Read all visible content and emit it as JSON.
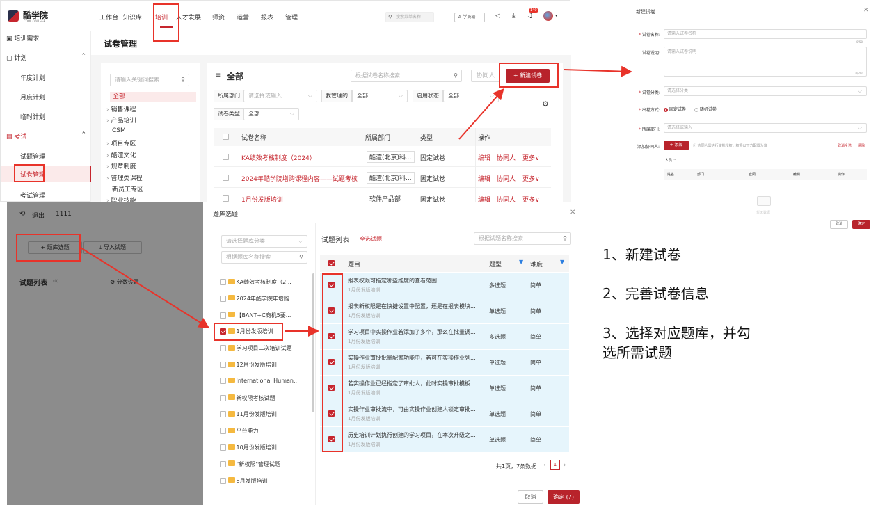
{
  "app": {
    "logo_cn": "酷学院",
    "logo_en": "COOL COLLEGE",
    "nav": [
      "工作台",
      "知识库",
      "培训",
      "人才发展",
      "师资",
      "运营",
      "报表",
      "管理"
    ],
    "search_placeholder": "搜索菜单名称",
    "role_label": "学员端",
    "badge_count": "140"
  },
  "sidebar": {
    "items": [
      {
        "label": "培训需求",
        "type": "group"
      },
      {
        "label": "计划",
        "type": "group"
      },
      {
        "label": "年度计划",
        "type": "sub"
      },
      {
        "label": "月度计划",
        "type": "sub"
      },
      {
        "label": "临时计划",
        "type": "sub"
      },
      {
        "label": "考试",
        "type": "group"
      },
      {
        "label": "试题管理",
        "type": "sub"
      },
      {
        "label": "试卷管理",
        "type": "sub"
      },
      {
        "label": "考试管理",
        "type": "sub"
      }
    ]
  },
  "main": {
    "page_title": "试卷管理",
    "tree_search_placeholder": "请输入关键词搜索",
    "tree": [
      "全部",
      "销售课程",
      "产品培训",
      "CSM",
      "项目专区",
      "酷渲文化",
      "规章制度",
      "管理类课程",
      "新员工专区",
      "职业技能"
    ],
    "section_title": "全部",
    "paper_search_placeholder": "根据试卷名称搜索",
    "collaborator_btn": "协同人",
    "new_paper_btn": "+ 新建试卷",
    "filters": {
      "dept_label": "所属部门",
      "dept_placeholder": "请选择或输入",
      "managed_label": "我管理的",
      "managed_value": "全部",
      "status_label": "启用状态",
      "status_value": "全部",
      "type_label": "试卷类型",
      "type_value": "全部"
    },
    "table": {
      "headers": [
        "试卷名称",
        "所属部门",
        "类型",
        "操作"
      ],
      "rows": [
        {
          "name": "KA绩效考核制度（2024）",
          "dept": "酷渲(北京)科...",
          "type": "固定试卷"
        },
        {
          "name": "2024年酷学院增购课程内容——试题考核",
          "dept": "酷渲(北京)科...",
          "type": "固定试卷"
        },
        {
          "name": "1月份发版培训",
          "dept": "软件产品部",
          "type": "固定试卷"
        }
      ],
      "actions": [
        "编辑",
        "协同人",
        "更多∨"
      ]
    }
  },
  "new_paper_dialog": {
    "title": "新建试卷",
    "name_label": "试卷名称:",
    "name_placeholder": "请输入试卷名称",
    "name_count": "0/50",
    "desc_label": "试卷说明:",
    "desc_placeholder": "请输入试卷说明",
    "desc_count": "0/200",
    "category_label": "试卷分类:",
    "category_placeholder": "请选择分类",
    "mode_label": "出卷方式:",
    "mode_fixed": "固定试卷",
    "mode_random": "随机试卷",
    "dept_label": "所属部门:",
    "dept_placeholder": "请选择或输入",
    "collab_label": "添加协同人:",
    "add_btn": "+ 添加",
    "collab_hint": "协同人需进行审批授权，权限以下方配置为准",
    "cancel_all": "取消全选",
    "clear": "清除",
    "people_label": "人员",
    "people_headers": [
      "姓名",
      "部门",
      "查阅",
      "编辑",
      "操作"
    ],
    "empty": "暂无数据",
    "cancel": "取消",
    "ok": "确定"
  },
  "editor": {
    "exit_label": "退出",
    "paper_name": "1111",
    "bank_btn": "+ 题库选题",
    "import_btn": "导入试题",
    "list_title": "试题列表",
    "list_count": "(0)",
    "score_setting": "分数设置"
  },
  "bank_dialog": {
    "title": "题库选题",
    "category_placeholder": "请选择题库分类",
    "search_placeholder": "根据题库名称搜索",
    "banks": [
      {
        "name": "KA绩效考核制度（2...",
        "checked": false
      },
      {
        "name": "2024年酷学院年增购...",
        "checked": false
      },
      {
        "name": "【BANT+C商机5要...",
        "checked": false
      },
      {
        "name": "1月份发版培训",
        "checked": true
      },
      {
        "name": "学习项目二次培训试题",
        "checked": false
      },
      {
        "name": "12月份发版培训",
        "checked": false
      },
      {
        "name": "International Human...",
        "checked": false
      },
      {
        "name": "新权限考核试题",
        "checked": false
      },
      {
        "name": "11月份发版培训",
        "checked": false
      },
      {
        "name": "平台能力",
        "checked": false
      },
      {
        "name": "10月份发版培训",
        "checked": false
      },
      {
        "name": "\"新权限\"管理试题",
        "checked": false
      },
      {
        "name": "8月发版培训",
        "checked": false
      }
    ],
    "list_title": "试题列表",
    "select_all": "全选试题",
    "question_search_placeholder": "根据试题名称搜索",
    "headers": [
      "题目",
      "题型",
      "难度"
    ],
    "questions": [
      {
        "title": "报表权限可指定哪些维度的查看范围",
        "source": "1月份发版培训",
        "type": "多选题",
        "level": "简单"
      },
      {
        "title": "报表新权限是在快捷设置中配置，还是在报表模块...",
        "source": "1月份发版培训",
        "type": "单选题",
        "level": "简单"
      },
      {
        "title": "学习项目中实操作业若添加了多个，那么在批量调...",
        "source": "1月份发版培训",
        "type": "多选题",
        "level": "简单"
      },
      {
        "title": "实操作业审批批量配置功能中，若可在实操作业列...",
        "source": "1月份发版培训",
        "type": "单选题",
        "level": "简单"
      },
      {
        "title": "若实操作业已经指定了审批人，此时实操审批模板...",
        "source": "1月份发版培训",
        "type": "单选题",
        "level": "简单"
      },
      {
        "title": "实操作业审批流中，可由实操作业创建人锁定审批...",
        "source": "1月份发版培训",
        "type": "单选题",
        "level": "简单"
      },
      {
        "title": "历史培训计划执行创建的学习项目，在本次升级之...",
        "source": "1月份发版培训",
        "type": "单选题",
        "level": "简单"
      }
    ],
    "pagination": "共1页，7条数据",
    "page": "1",
    "cancel": "取消",
    "ok": "确定 (7)"
  },
  "steps": [
    "1、新建试卷",
    "2、完善试卷信息",
    "3、选择对应题库，并勾",
    "选所需试题"
  ]
}
